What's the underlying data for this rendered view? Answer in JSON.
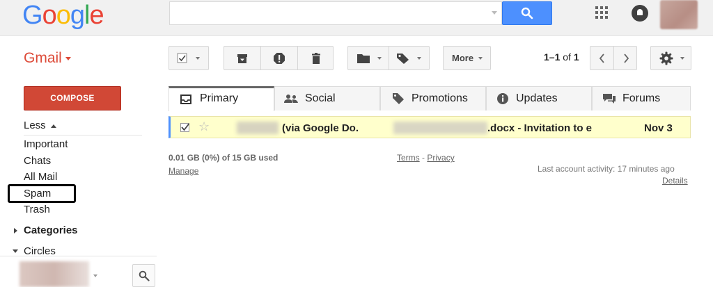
{
  "header": {
    "logo_letters": [
      {
        "ch": "G",
        "color": "#4285f4"
      },
      {
        "ch": "o",
        "color": "#ea4335"
      },
      {
        "ch": "o",
        "color": "#fbbc05"
      },
      {
        "ch": "g",
        "color": "#4285f4"
      },
      {
        "ch": "l",
        "color": "#34a853"
      },
      {
        "ch": "e",
        "color": "#ea4335"
      }
    ],
    "search_placeholder": "",
    "icons": [
      "search-icon",
      "apps-grid-icon",
      "notifications-icon",
      "account-avatar"
    ]
  },
  "toolbar": {
    "app_label": "Gmail",
    "more_label": "More",
    "pager": {
      "range": "1–1",
      "of": "of",
      "total": "1"
    },
    "icons": [
      "select-checkbox-icon",
      "archive-icon",
      "report-spam-icon",
      "delete-icon",
      "move-to-folder-icon",
      "labels-icon",
      "prev-icon",
      "next-icon",
      "settings-gear-icon"
    ]
  },
  "sidebar": {
    "compose_label": "COMPOSE",
    "less_label": "Less",
    "items": [
      "Important",
      "Chats",
      "All Mail",
      "Spam",
      "Trash"
    ],
    "categories_label": "Categories",
    "circles_label": "Circles"
  },
  "tabs": [
    {
      "label": "Primary",
      "icon": "inbox-icon",
      "active": true
    },
    {
      "label": "Social",
      "icon": "people-icon",
      "active": false
    },
    {
      "label": "Promotions",
      "icon": "tag-icon",
      "active": false
    },
    {
      "label": "Updates",
      "icon": "info-icon",
      "active": false
    },
    {
      "label": "Forums",
      "icon": "chat-icon",
      "active": false
    }
  ],
  "message": {
    "sender": "(via Google Do.",
    "subject": ".docx - Invitation to e",
    "date": "Nov 3"
  },
  "footer": {
    "storage": "0.01 GB (0%) of 15 GB used",
    "manage": "Manage",
    "terms": "Terms",
    "dash": "-",
    "privacy": "Privacy",
    "activity": "Last account activity: 17 minutes ago",
    "details": "Details"
  },
  "colors": {
    "brand_red": "#dd4b39",
    "compose_red": "#d14836",
    "search_blue": "#4d90fe",
    "unread_row": "#ffffcc"
  }
}
